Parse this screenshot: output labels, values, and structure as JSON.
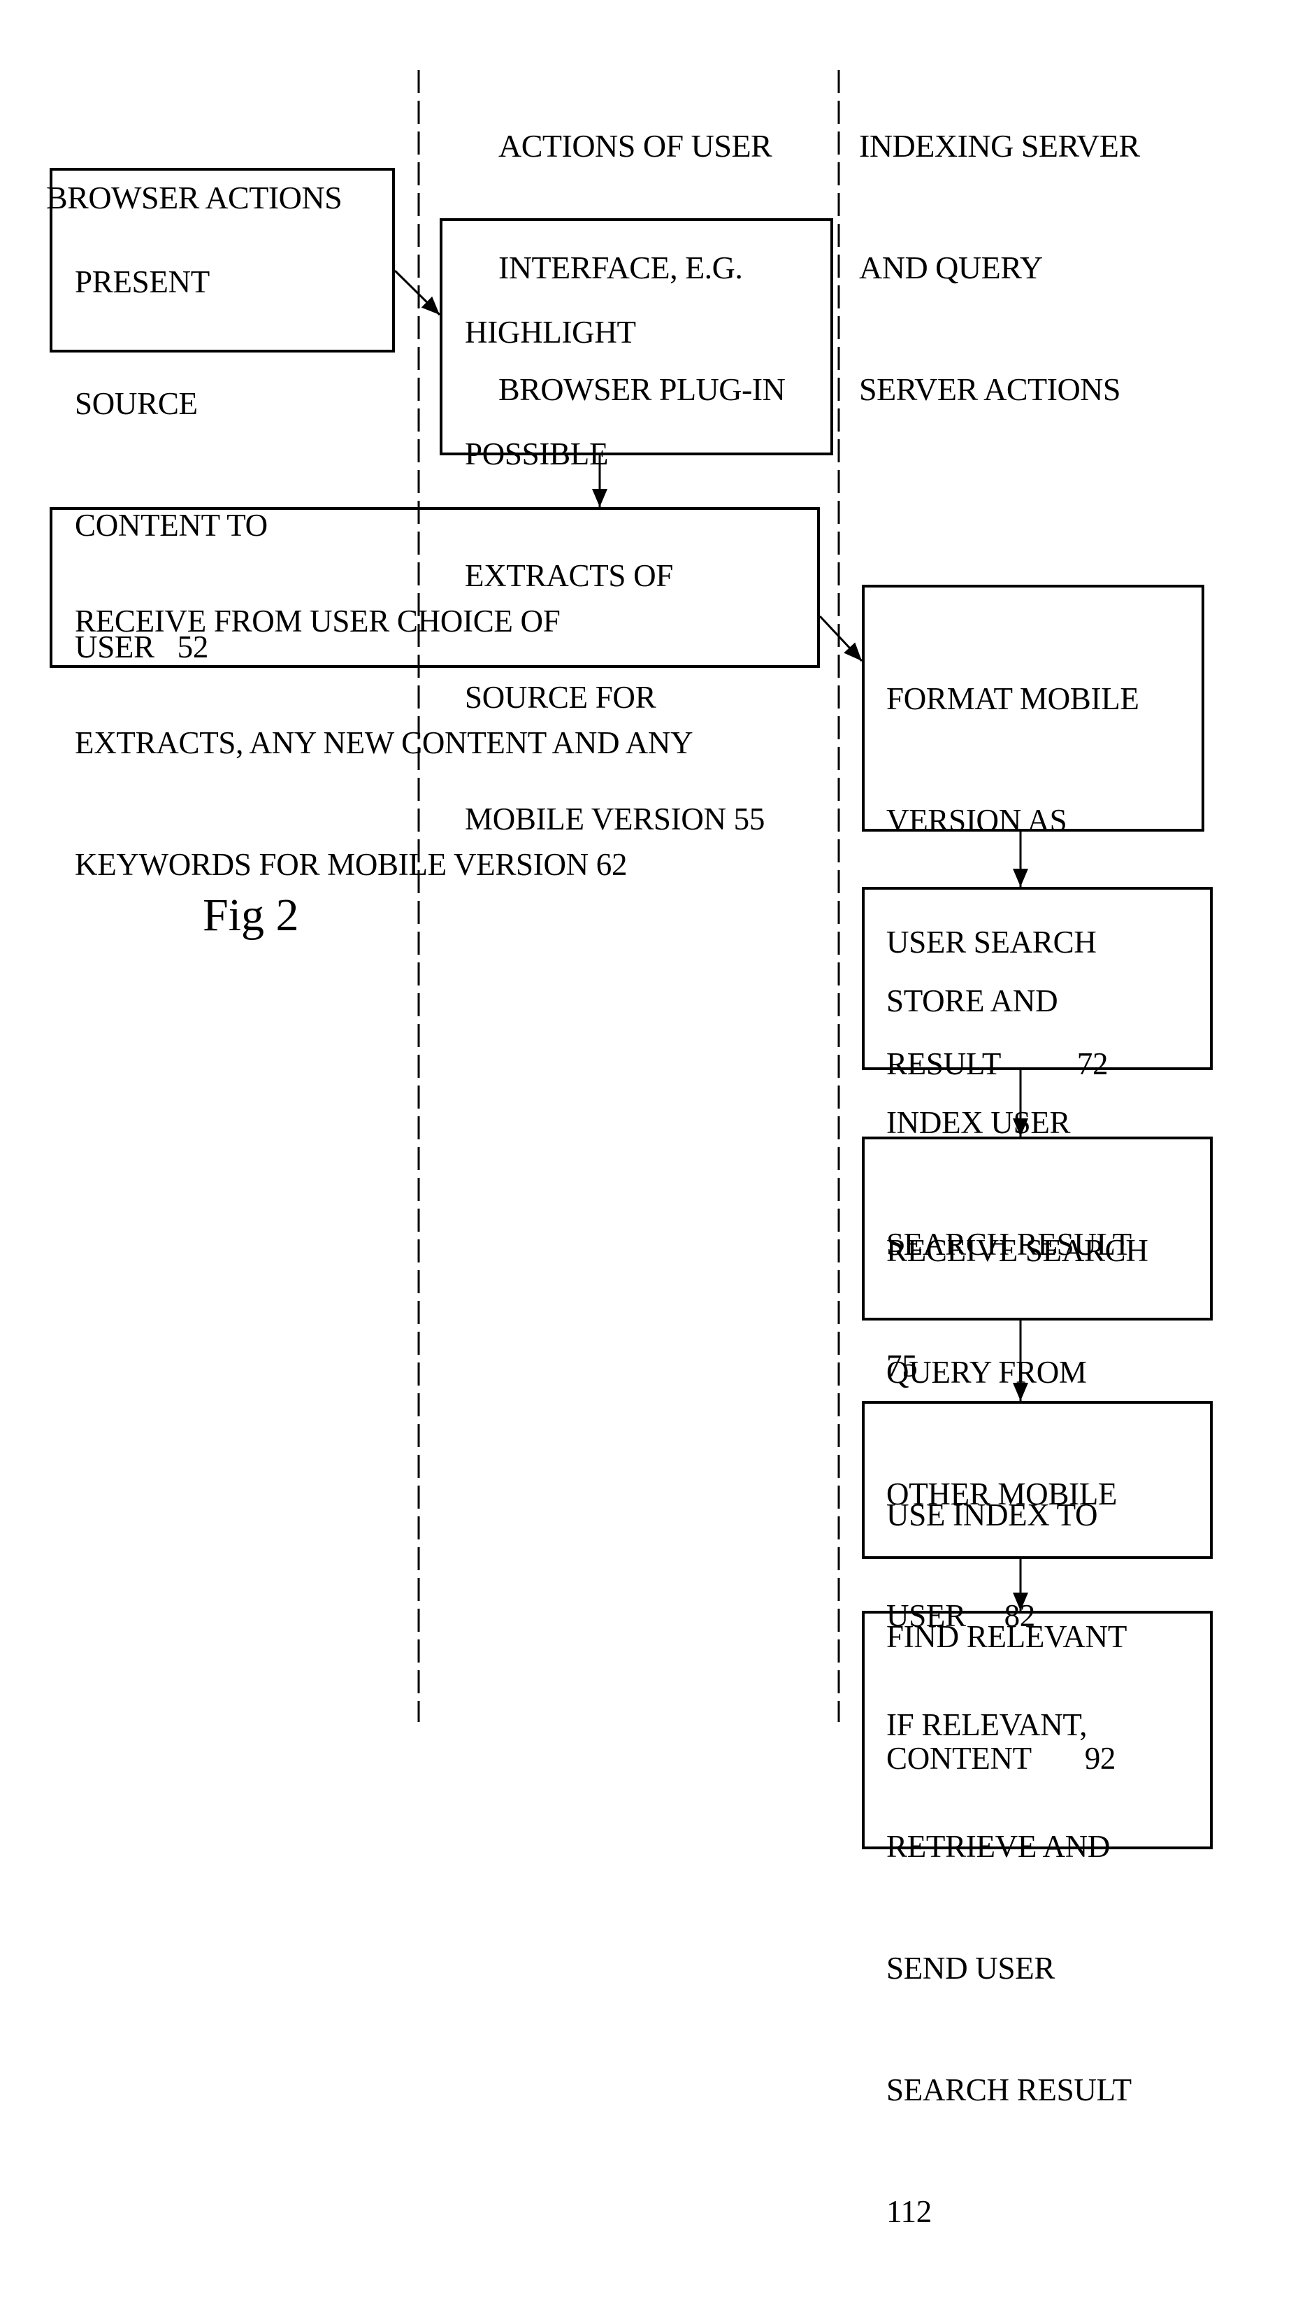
{
  "figure_label": "Fig 2",
  "lanes": [
    {
      "id": "browser",
      "header": [
        "BROWSER ACTIONS"
      ]
    },
    {
      "id": "ui",
      "header": [
        "ACTIONS OF USER",
        "INTERFACE, E.G.",
        "BROWSER PLUG-IN"
      ]
    },
    {
      "id": "server",
      "header": [
        "INDEXING SERVER",
        "AND QUERY",
        "SERVER ACTIONS"
      ]
    }
  ],
  "steps": [
    {
      "id": "52",
      "lane": "browser",
      "lines": [
        "PRESENT",
        "SOURCE",
        "CONTENT TO",
        "USER   52"
      ]
    },
    {
      "id": "55",
      "lane": "ui",
      "lines": [
        "HIGHLIGHT",
        "POSSIBLE",
        "EXTRACTS OF",
        "SOURCE FOR",
        "MOBILE VERSION 55"
      ]
    },
    {
      "id": "62",
      "lane": "browser",
      "lines": [
        "RECEIVE FROM USER CHOICE OF",
        "EXTRACTS, ANY NEW CONTENT AND ANY",
        "KEYWORDS FOR MOBILE VERSION 62"
      ]
    },
    {
      "id": "72",
      "lane": "server",
      "lines": [
        "FORMAT MOBILE",
        "VERSION AS",
        "USER SEARCH",
        "RESULT          72"
      ]
    },
    {
      "id": "75",
      "lane": "server",
      "lines": [
        "STORE AND",
        "INDEX USER",
        "SEARCH RESULT",
        "75"
      ]
    },
    {
      "id": "82",
      "lane": "server",
      "lines": [
        "RECEIVE SEARCH",
        "QUERY FROM",
        "OTHER MOBILE",
        "USER     82"
      ]
    },
    {
      "id": "92",
      "lane": "server",
      "lines": [
        "USE INDEX TO",
        "FIND RELEVANT",
        "CONTENT       92"
      ]
    },
    {
      "id": "112",
      "lane": "server",
      "lines": [
        "IF RELEVANT,",
        "RETRIEVE AND",
        "SEND USER",
        "SEARCH RESULT",
        "112"
      ]
    }
  ],
  "flows": [
    {
      "from": "52",
      "to": "55"
    },
    {
      "from": "55",
      "to": "62"
    },
    {
      "from": "62",
      "to": "72"
    },
    {
      "from": "72",
      "to": "75"
    },
    {
      "from": "75",
      "to": "82"
    },
    {
      "from": "82",
      "to": "92"
    },
    {
      "from": "92",
      "to": "112"
    }
  ]
}
